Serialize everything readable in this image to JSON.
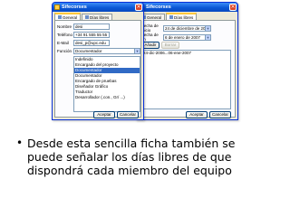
{
  "window1": {
    "title": "Sifecorses",
    "tabs": [
      {
        "label": "General"
      },
      {
        "label": "Días libres"
      }
    ],
    "labels": {
      "nombre": "Nombre",
      "telefono": "Teléfono",
      "email": "E-Mail",
      "funcion": "Función"
    },
    "fields": {
      "nombre": "desi",
      "telefono": "+34 91 555 55 55",
      "email": "desi_p@upc.edu"
    },
    "funcion_selected": "Documentador",
    "list_items": [
      {
        "label": "Indefinido"
      },
      {
        "label": "Encargado del proyecto"
      },
      {
        "label": "Documentador"
      },
      {
        "label": "Documentador"
      },
      {
        "label": "Encargado de pruebas"
      },
      {
        "label": "Diseñador Gráfico"
      },
      {
        "label": "Traductor"
      },
      {
        "label": "Desarrollador (.con., Gr/ ...)"
      }
    ],
    "buttons": {
      "accept": "Aceptar",
      "cancel": "Cancelar"
    }
  },
  "window2": {
    "title": "Sifecorses",
    "tabs": [
      {
        "label": "General"
      },
      {
        "label": "Días libres"
      }
    ],
    "labels": {
      "inicio": "Fecha de inicio",
      "fin": "Fecha de fin"
    },
    "fields": {
      "inicio": "24 de diciembre de 2006",
      "fin": "6 de enero de 2007"
    },
    "buttons": {
      "add": "Añadir",
      "remove": "Borrar",
      "accept": "Aceptar",
      "cancel": "Cancelar"
    },
    "list_items": [
      {
        "label": "24-dic-2006...06-ene-2007"
      }
    ]
  },
  "bullet_text": "Desde esta sencilla ficha también se puede señalar los días libres de que dispondrá cada miembro del equipo"
}
